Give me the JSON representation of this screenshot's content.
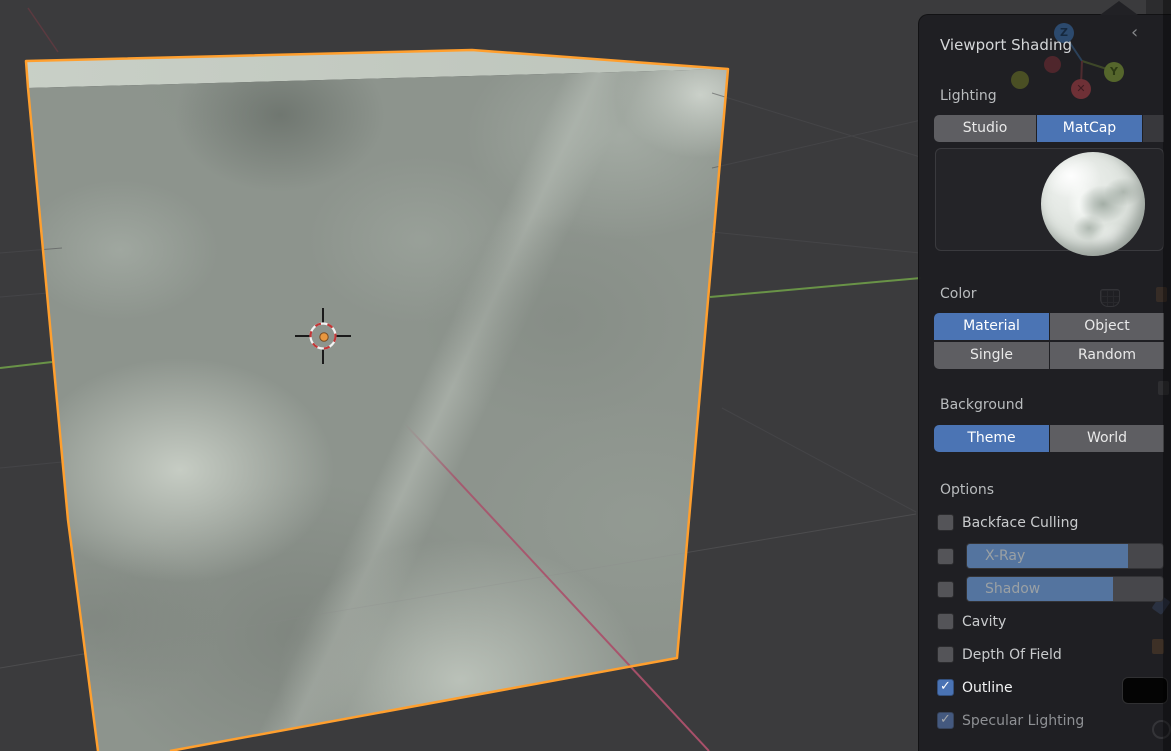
{
  "panel": {
    "title": "Viewport Shading",
    "lighting": {
      "label": "Lighting",
      "options": [
        "Studio",
        "MatCap"
      ],
      "selected": "MatCap"
    },
    "color": {
      "label": "Color",
      "options": [
        "Material",
        "Object",
        "Single",
        "Random"
      ],
      "selected": "Material"
    },
    "background": {
      "label": "Background",
      "options": [
        "Theme",
        "World"
      ],
      "selected": "Theme"
    },
    "options": {
      "label": "Options",
      "items": [
        {
          "label": "Backface Culling",
          "checked": false
        },
        {
          "label": "X-Ray",
          "checked": false,
          "slider": true
        },
        {
          "label": "Shadow",
          "checked": false,
          "slider": true
        },
        {
          "label": "Cavity",
          "checked": false
        },
        {
          "label": "Depth Of Field",
          "checked": false
        },
        {
          "label": "Outline",
          "checked": true,
          "swatch_color": "#040404"
        },
        {
          "label": "Specular Lighting",
          "checked": true,
          "disabled": true
        }
      ]
    }
  },
  "viewport": {
    "gizmo": {
      "z_label": "Z",
      "y_label": "Y",
      "x_label": "✕"
    },
    "colors": {
      "selection_outline": "#ff9f2e",
      "axis_x": "#a9506a",
      "axis_y": "#6f9d49",
      "accent_blue": "#4b74b4",
      "background": "#3b3b3d",
      "panel_background": "#1e1e22"
    }
  }
}
